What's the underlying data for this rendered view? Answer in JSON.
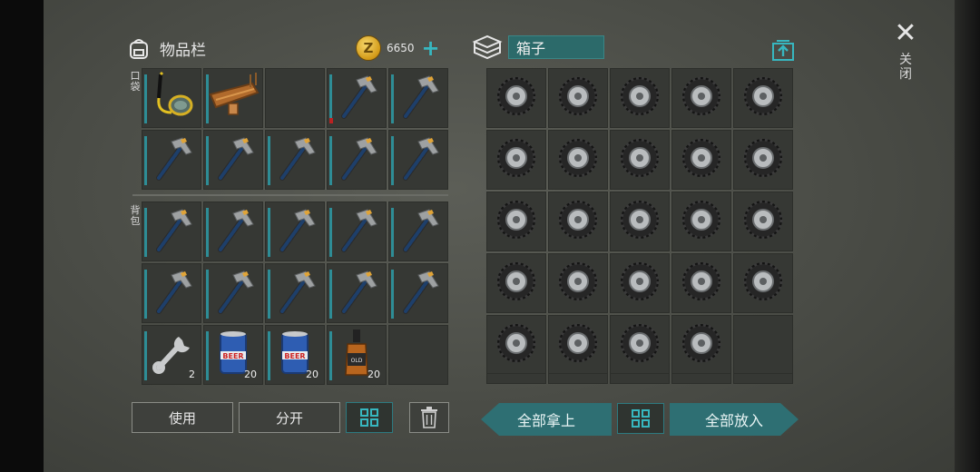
{
  "inventory": {
    "title": "物品栏",
    "coins": "6650",
    "pocket_label": "口袋",
    "backpack_label": "背包",
    "slots": [
      {
        "item": "diving-mask-icon",
        "qty": ""
      },
      {
        "item": "wooden-sled-icon",
        "qty": ""
      },
      {
        "item": "",
        "qty": ""
      },
      {
        "item": "hatchet-icon",
        "qty": ""
      },
      {
        "item": "hatchet-icon",
        "qty": ""
      },
      {
        "item": "hatchet-icon",
        "qty": ""
      },
      {
        "item": "hatchet-icon",
        "qty": ""
      },
      {
        "item": "hatchet-icon",
        "qty": ""
      },
      {
        "item": "hatchet-icon",
        "qty": ""
      },
      {
        "item": "hatchet-icon",
        "qty": ""
      },
      {
        "item": "hatchet-icon",
        "qty": ""
      },
      {
        "item": "hatchet-icon",
        "qty": ""
      },
      {
        "item": "hatchet-icon",
        "qty": ""
      },
      {
        "item": "hatchet-icon",
        "qty": ""
      },
      {
        "item": "hatchet-icon",
        "qty": ""
      },
      {
        "item": "hatchet-icon",
        "qty": ""
      },
      {
        "item": "hatchet-icon",
        "qty": ""
      },
      {
        "item": "hatchet-icon",
        "qty": ""
      },
      {
        "item": "hatchet-icon",
        "qty": ""
      },
      {
        "item": "hatchet-icon",
        "qty": ""
      },
      {
        "item": "wrench-icon",
        "qty": "2"
      },
      {
        "item": "beer-can-icon",
        "qty": "20"
      },
      {
        "item": "beer-can-icon",
        "qty": "20"
      },
      {
        "item": "whiskey-bottle-icon",
        "qty": "20"
      },
      {
        "item": "",
        "qty": ""
      }
    ],
    "buttons": {
      "use": "使用",
      "split": "分开"
    }
  },
  "box": {
    "title": "箱子",
    "slots": [
      "tire-icon",
      "tire-icon",
      "tire-icon",
      "tire-icon",
      "tire-icon",
      "tire-icon",
      "tire-icon",
      "tire-icon",
      "tire-icon",
      "tire-icon",
      "tire-icon",
      "tire-icon",
      "tire-icon",
      "tire-icon",
      "tire-icon",
      "tire-icon",
      "tire-icon",
      "tire-icon",
      "tire-icon",
      "tire-icon",
      "tire-icon",
      "tire-icon",
      "tire-icon",
      "tire-icon",
      ""
    ],
    "buttons": {
      "take_all": "全部拿上",
      "put_all": "全部放入"
    }
  },
  "close_label": "关闭",
  "colors": {
    "accent": "#2e6f73",
    "tag": "#2e8d96",
    "slot": "#363834",
    "coin": "#e3b63a"
  }
}
